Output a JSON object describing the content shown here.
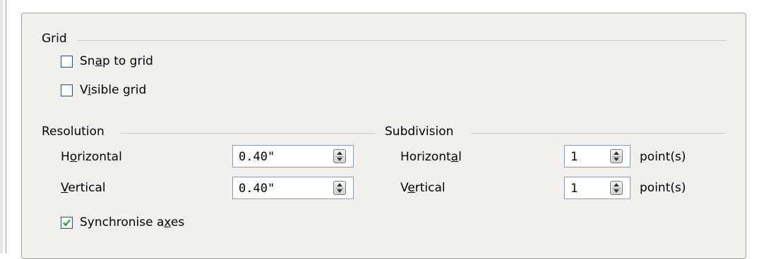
{
  "grid": {
    "heading": "Grid",
    "snap_to_grid": {
      "pre": "Sn",
      "key": "a",
      "post": "p to grid",
      "checked": false
    },
    "visible_grid": {
      "pre": "V",
      "key": "i",
      "post": "sible grid",
      "checked": false
    }
  },
  "resolution": {
    "heading": "Resolution",
    "horizontal": {
      "pre": "H",
      "key": "o",
      "post": "rizontal",
      "value": "0.40\""
    },
    "vertical": {
      "pre": "",
      "key": "V",
      "post": "ertical",
      "value": "0.40\""
    },
    "synchronise_axes": {
      "pre": "Synchronise a",
      "key": "x",
      "post": "es",
      "checked": true
    }
  },
  "subdivision": {
    "heading": "Subdivision",
    "horizontal": {
      "pre": "Horizont",
      "key": "a",
      "post": "l",
      "value": "1",
      "unit": "point(s)"
    },
    "vertical": {
      "pre": "V",
      "key": "e",
      "post": "rtical",
      "value": "1",
      "unit": "point(s)"
    }
  },
  "colors": {
    "panel_bg": "#f1f0ec",
    "checkbox_border": "#1c5180",
    "checkmark": "#22a322",
    "input_border": "#7f9db9"
  }
}
